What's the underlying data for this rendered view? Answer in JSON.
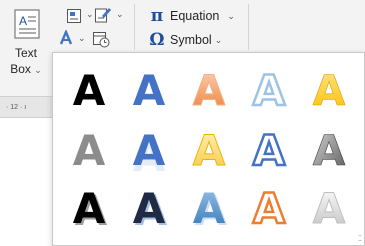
{
  "insert_text_group": {
    "text_box_line1": "Text",
    "text_box_line2": "Box",
    "text_box_caret": "⌄"
  },
  "symbols_group": {
    "equation_glyph": "π",
    "equation_label": "Equation",
    "symbol_glyph": "Ω",
    "symbol_label": "Symbol"
  },
  "ruler": {
    "label": "· 12 · ı"
  },
  "wordart_gallery": {
    "letter": "A",
    "styles": [
      {
        "row": 1,
        "col": 1,
        "style": "black-fill"
      },
      {
        "row": 1,
        "col": 2,
        "style": "blue-fill"
      },
      {
        "row": 1,
        "col": 3,
        "style": "orange-gradient"
      },
      {
        "row": 1,
        "col": 4,
        "style": "light-blue-outline"
      },
      {
        "row": 1,
        "col": 5,
        "style": "gold-fill"
      },
      {
        "row": 2,
        "col": 1,
        "style": "gray-fill"
      },
      {
        "row": 2,
        "col": 2,
        "style": "blue-reflection"
      },
      {
        "row": 2,
        "col": 3,
        "style": "gold-gradient"
      },
      {
        "row": 2,
        "col": 4,
        "style": "blue-outline"
      },
      {
        "row": 2,
        "col": 5,
        "style": "gray-bevel"
      },
      {
        "row": 3,
        "col": 1,
        "style": "black-shadow"
      },
      {
        "row": 3,
        "col": 2,
        "style": "dark-shadow"
      },
      {
        "row": 3,
        "col": 3,
        "style": "blue-gradient"
      },
      {
        "row": 3,
        "col": 4,
        "style": "orange-outline"
      },
      {
        "row": 3,
        "col": 5,
        "style": "white-silver"
      }
    ]
  },
  "colors": {
    "ribbon_bg": "#f3f3f3",
    "accent_blue": "#1f4e9b",
    "wordart_blue": "#4472c4",
    "wordart_orange": "#ed7d31",
    "wordart_gold": "#ffc000"
  }
}
